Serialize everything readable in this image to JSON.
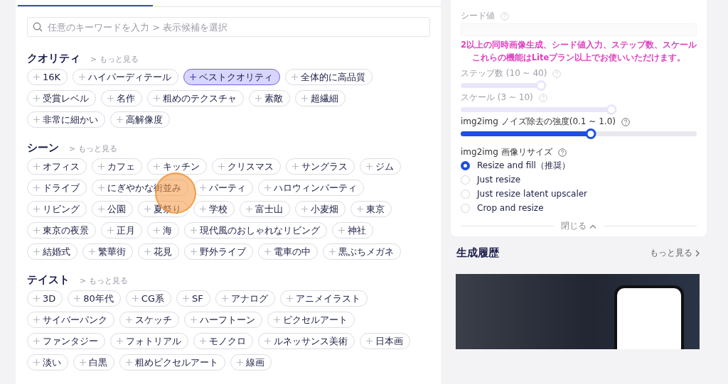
{
  "search": {
    "placeholder": "任意のキーワードを入力 > 表示候補を選択"
  },
  "tag_sections": [
    {
      "title": "クオリティ",
      "more_link": "> もっと見る",
      "tags": [
        {
          "label": "16K",
          "selected": false
        },
        {
          "label": "ハイパーディテール",
          "selected": false
        },
        {
          "label": "ベストクオリティ",
          "selected": true
        },
        {
          "label": "全体的に高品質",
          "selected": false
        },
        {
          "label": "受賞レベル",
          "selected": false
        },
        {
          "label": "名作",
          "selected": false
        },
        {
          "label": "粗めのテクスチャ",
          "selected": false
        },
        {
          "label": "素敵",
          "selected": false
        },
        {
          "label": "超繊細",
          "selected": false
        },
        {
          "label": "非常に細かい",
          "selected": false
        },
        {
          "label": "高解像度",
          "selected": false
        }
      ]
    },
    {
      "title": "シーン",
      "more_link": "> もっと見る",
      "tags": [
        {
          "label": "オフィス",
          "selected": false
        },
        {
          "label": "カフェ",
          "selected": false
        },
        {
          "label": "キッチン",
          "selected": false
        },
        {
          "label": "クリスマス",
          "selected": false
        },
        {
          "label": "サングラス",
          "selected": false
        },
        {
          "label": "ジム",
          "selected": false
        },
        {
          "label": "ドライブ",
          "selected": false
        },
        {
          "label": "にぎやかな街並み",
          "selected": false
        },
        {
          "label": "パーティ",
          "selected": false
        },
        {
          "label": "ハロウィンパーティ",
          "selected": false
        },
        {
          "label": "リビング",
          "selected": false
        },
        {
          "label": "公園",
          "selected": false
        },
        {
          "label": "夏祭り",
          "selected": false
        },
        {
          "label": "学校",
          "selected": false
        },
        {
          "label": "富士山",
          "selected": false
        },
        {
          "label": "小麦畑",
          "selected": false
        },
        {
          "label": "東京",
          "selected": false
        },
        {
          "label": "東京の夜景",
          "selected": false
        },
        {
          "label": "正月",
          "selected": false
        },
        {
          "label": "海",
          "selected": false
        },
        {
          "label": "現代風のおしゃれなリビング",
          "selected": false
        },
        {
          "label": "神社",
          "selected": false
        },
        {
          "label": "結婚式",
          "selected": false
        },
        {
          "label": "繁華街",
          "selected": false
        },
        {
          "label": "花見",
          "selected": false
        },
        {
          "label": "野外ライブ",
          "selected": false
        },
        {
          "label": "電車の中",
          "selected": false
        },
        {
          "label": "黒ぶちメガネ",
          "selected": false
        }
      ]
    },
    {
      "title": "テイスト",
      "more_link": "> もっと見る",
      "tags": [
        {
          "label": "3D",
          "selected": false
        },
        {
          "label": "80年代",
          "selected": false
        },
        {
          "label": "CG系",
          "selected": false
        },
        {
          "label": "SF",
          "selected": false
        },
        {
          "label": "アナログ",
          "selected": false
        },
        {
          "label": "アニメイラスト",
          "selected": false
        },
        {
          "label": "サイバーパンク",
          "selected": false
        },
        {
          "label": "スケッチ",
          "selected": false
        },
        {
          "label": "ハーフトーン",
          "selected": false
        },
        {
          "label": "ピクセルアート",
          "selected": false
        },
        {
          "label": "ファンタジー",
          "selected": false
        },
        {
          "label": "フォトリアル",
          "selected": false
        },
        {
          "label": "モノクロ",
          "selected": false
        },
        {
          "label": "ルネッサンス美術",
          "selected": false
        },
        {
          "label": "日本画",
          "selected": false
        },
        {
          "label": "淡い",
          "selected": false
        },
        {
          "label": "白黒",
          "selected": false
        },
        {
          "label": "粗めピクセルアート",
          "selected": false
        },
        {
          "label": "線画",
          "selected": false
        }
      ]
    }
  ],
  "settings": {
    "seed_label": "シード値",
    "upgrade_notice": [
      "2以上の同時画像生成、シード値入力、ステップ数、スケール",
      "これらの機能はLiteプラン以上でお使いいただけます。"
    ],
    "sliders": [
      {
        "label": "ステップ数 (10 ~ 40)",
        "level": 0.34,
        "locked": true
      },
      {
        "label": "スケール (3 ~ 10)",
        "level": 0.64,
        "locked": true
      },
      {
        "label": "img2img ノイズ除去の強度(0.1 ~ 1.0)",
        "level": 0.55,
        "locked": false
      }
    ],
    "resize": {
      "label": "img2img 画像リサイズ",
      "options": [
        {
          "label": "Resize and fill（推奨）",
          "selected": true
        },
        {
          "label": "Just resize",
          "selected": false
        },
        {
          "label": "Just resize latent upscaler",
          "selected": false
        },
        {
          "label": "Crop and resize",
          "selected": false
        }
      ]
    },
    "collapse": "閉じる"
  },
  "history": {
    "title": "生成履歴",
    "more_link": "もっと見る"
  }
}
